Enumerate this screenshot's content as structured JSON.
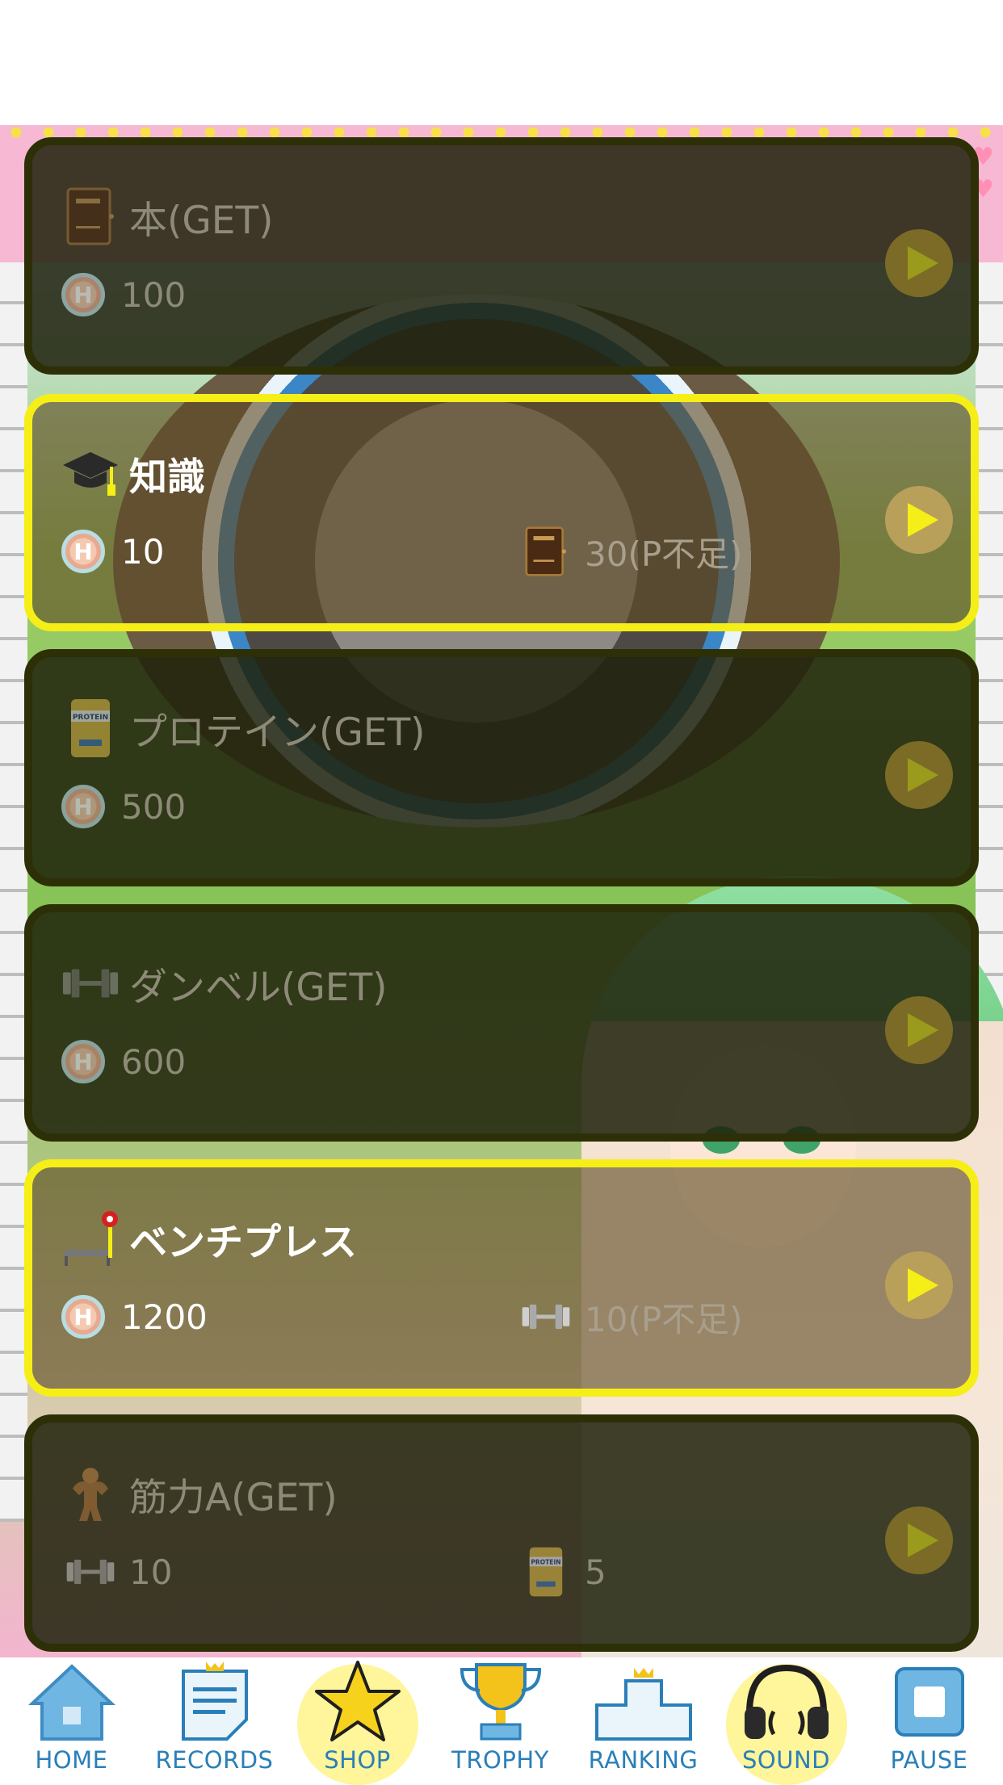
{
  "items": [
    {
      "title": "本(GET)",
      "icon": "book-icon",
      "cost_coin": "100",
      "cost_item": null,
      "active": false
    },
    {
      "title": "知識",
      "icon": "graduation-cap-icon",
      "cost_coin": "10",
      "cost_item": {
        "icon": "book-icon",
        "text": "30(P不足)"
      },
      "active": true
    },
    {
      "title": "プロテイン(GET)",
      "icon": "protein-can-icon",
      "cost_coin": "500",
      "cost_item": null,
      "active": false
    },
    {
      "title": "ダンベル(GET)",
      "icon": "dumbbell-icon",
      "cost_coin": "600",
      "cost_item": null,
      "active": false
    },
    {
      "title": "ベンチプレス",
      "icon": "bench-press-icon",
      "cost_coin": "1200",
      "cost_item": {
        "icon": "dumbbell-icon",
        "text": "10(P不足)"
      },
      "active": true
    },
    {
      "title": "筋力A(GET)",
      "icon": "muscle-man-icon",
      "cost_coin": null,
      "cost_first": {
        "icon": "dumbbell-icon",
        "text": "10"
      },
      "cost_item": {
        "icon": "protein-can-icon",
        "text": "5"
      },
      "active": false
    }
  ],
  "coin_letter": "H",
  "tabs": [
    {
      "label": "HOME",
      "icon": "home-icon",
      "highlight": false
    },
    {
      "label": "RECORDS",
      "icon": "records-icon",
      "highlight": false
    },
    {
      "label": "SHOP",
      "icon": "star-icon",
      "highlight": true
    },
    {
      "label": "TROPHY",
      "icon": "trophy-icon",
      "highlight": false
    },
    {
      "label": "RANKING",
      "icon": "podium-icon",
      "highlight": false
    },
    {
      "label": "SOUND",
      "icon": "headphones-icon",
      "highlight": true
    },
    {
      "label": "PAUSE",
      "icon": "pause-icon",
      "highlight": false
    }
  ],
  "colors": {
    "accent_yellow": "#f6ee17",
    "tab_blue": "#2a7fb8",
    "tab_glow": "#fff59a"
  }
}
